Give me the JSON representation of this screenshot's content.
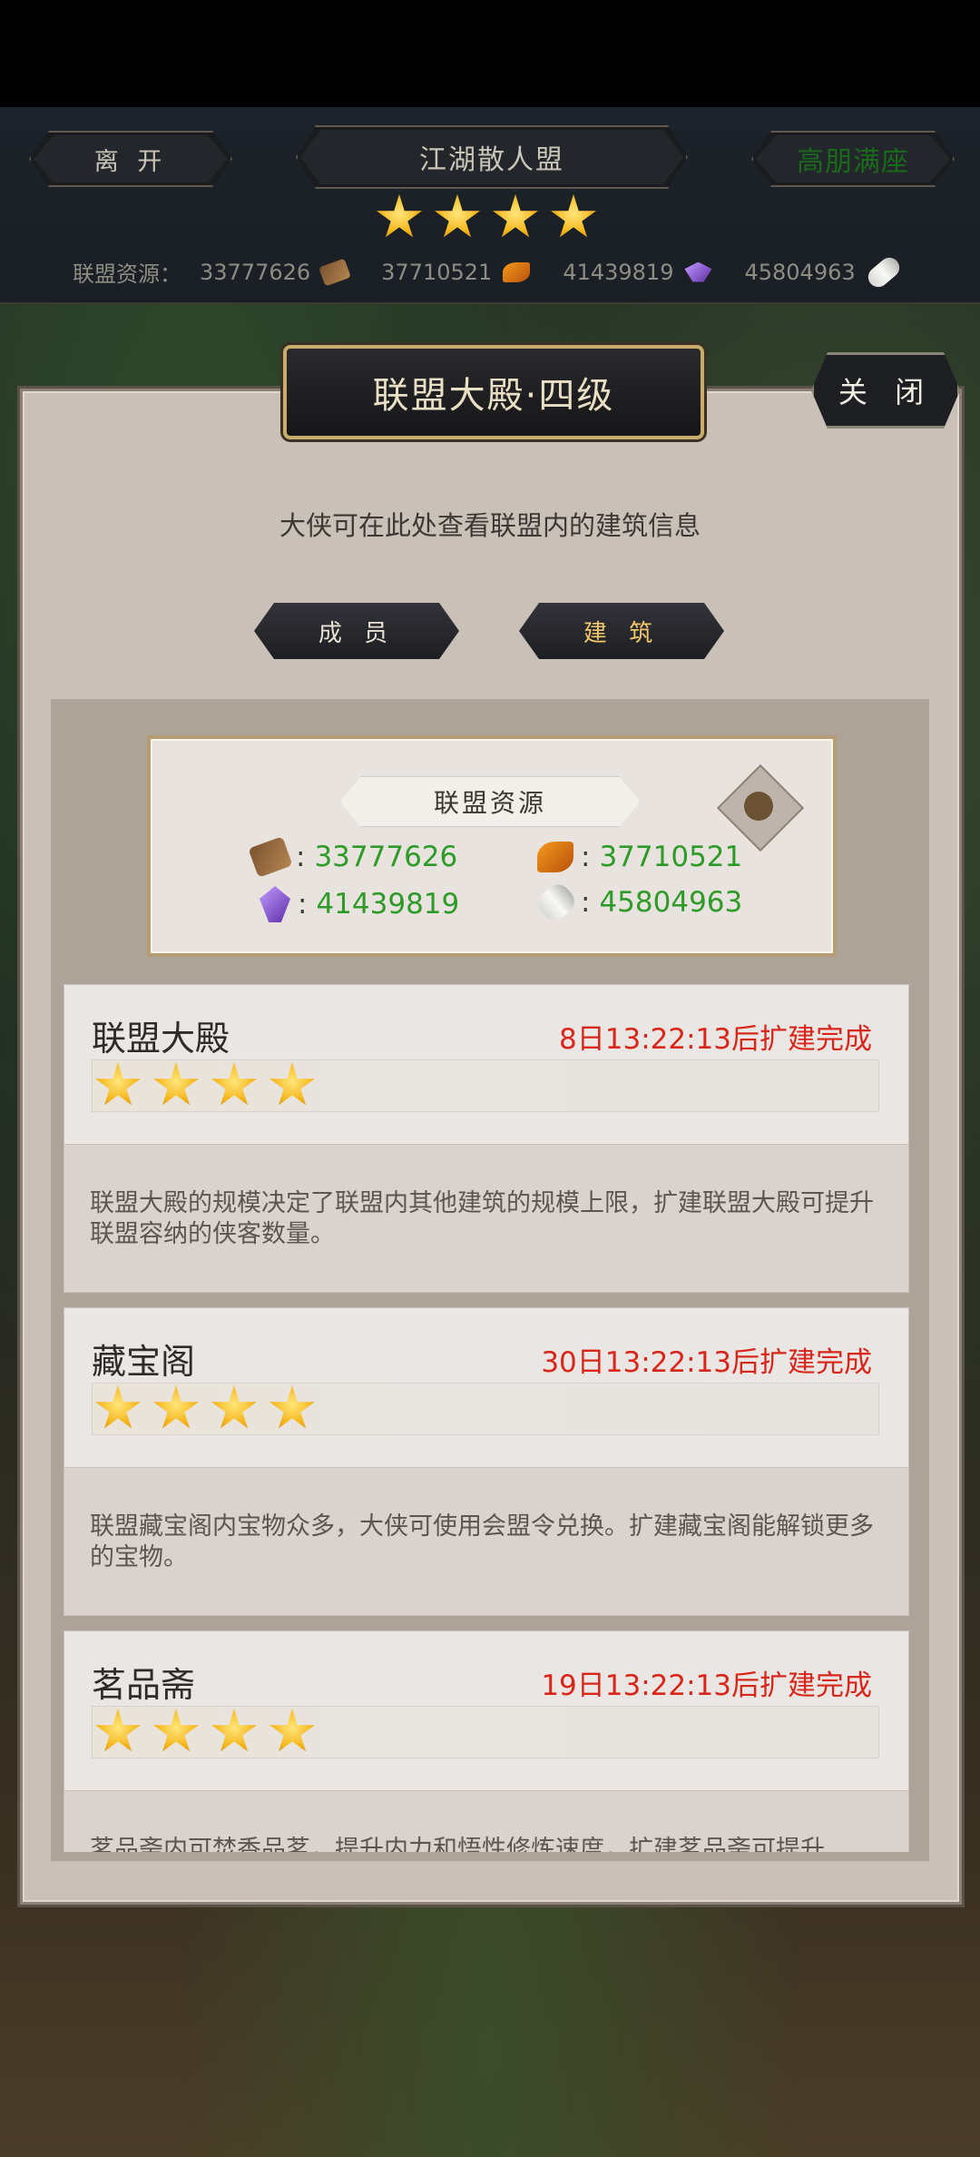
{
  "top": {
    "leave_label": "离 开",
    "alliance_name": "江湖散人盟",
    "status_label": "高朋满座",
    "stars": 4,
    "resources_label": "联盟资源：",
    "resources": [
      "33777626",
      "37710521",
      "41439819",
      "45804963"
    ]
  },
  "panel": {
    "title": "联盟大殿·四级",
    "close_label": "关 闭",
    "description": "大侠可在此处查看联盟内的建筑信息",
    "tabs": [
      {
        "label": "成 员",
        "active": false
      },
      {
        "label": "建 筑",
        "active": true
      }
    ],
    "resource_box": {
      "label": "联盟资源",
      "wood": "33777626",
      "ore": "37710521",
      "gem": "41439819",
      "scroll": "45804963"
    },
    "buildings": [
      {
        "name": "联盟大殿",
        "time": "8日13:22:13后扩建完成",
        "stars": 4,
        "desc": "联盟大殿的规模决定了联盟内其他建筑的规模上限，扩建联盟大殿可提升联盟容纳的侠客数量。"
      },
      {
        "name": "藏宝阁",
        "time": "30日13:22:13后扩建完成",
        "stars": 4,
        "desc": "联盟藏宝阁内宝物众多，大侠可使用会盟令兑换。扩建藏宝阁能解锁更多的宝物。"
      },
      {
        "name": "茗品斋",
        "time": "19日13:22:13后扩建完成",
        "stars": 4,
        "desc": "茗品斋内可焚香品茗，提升内力和悟性修炼速度，扩建茗品斋可提升"
      }
    ]
  },
  "colors": {
    "accent_green": "#2e9a27",
    "time_red": "#d8261b",
    "gold": "#c8ac6c"
  }
}
